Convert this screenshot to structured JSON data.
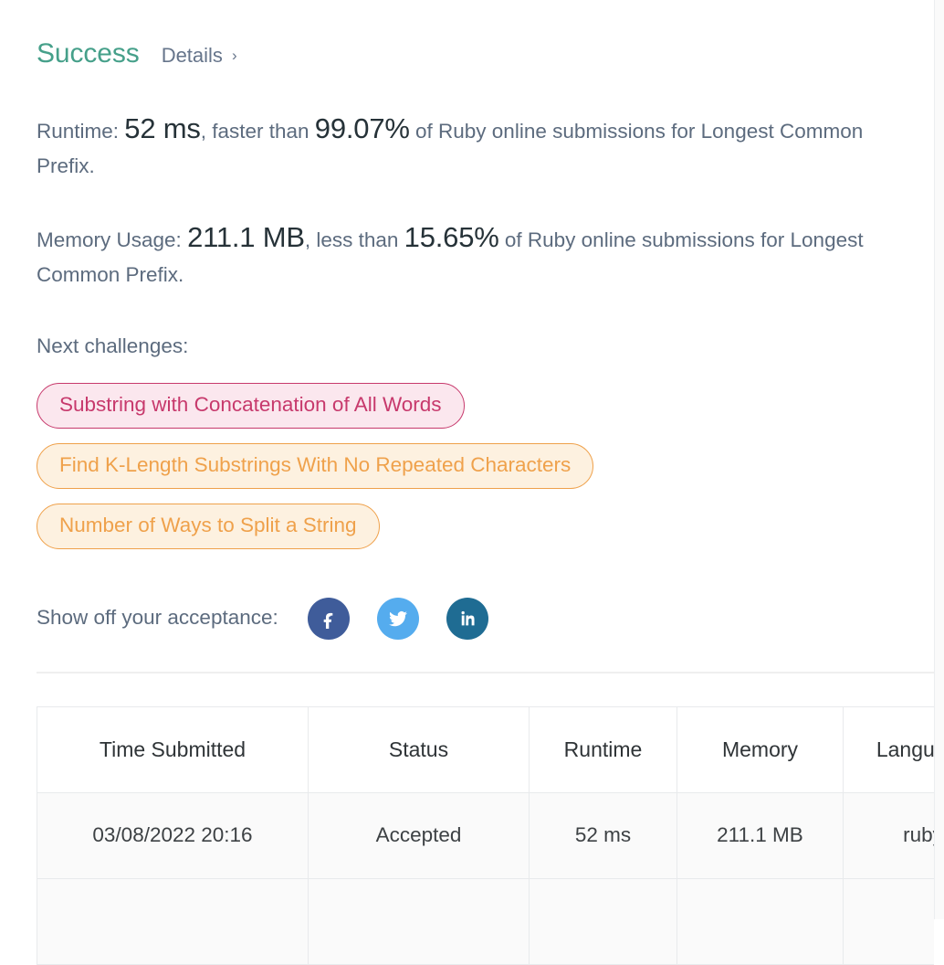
{
  "header": {
    "status": "Success",
    "details_label": "Details",
    "chevron": "›",
    "status_color": "#46a08a"
  },
  "runtime_stat": {
    "prefix": "Runtime: ",
    "value": "52 ms",
    "middle": ", faster than ",
    "percent": "99.07%",
    "suffix": " of Ruby online submissions for Longest Common Prefix."
  },
  "memory_stat": {
    "prefix": "Memory Usage: ",
    "value": "211.1 MB",
    "middle": ", less than ",
    "percent": "15.65%",
    "suffix": " of Ruby online submissions for Longest Common Prefix."
  },
  "next_challenges": {
    "label": "Next challenges:",
    "items": [
      {
        "title": "Substring with Concatenation of All Words",
        "difficulty": "hard",
        "color": "#c7396c",
        "background": "#fbe7ee"
      },
      {
        "title": "Find K-Length Substrings With No Repeated Characters",
        "difficulty": "medium",
        "color": "#efa14b",
        "background": "#fdf1e0"
      },
      {
        "title": "Number of Ways to Split a String",
        "difficulty": "medium",
        "color": "#efa14b",
        "background": "#fdf1e0"
      }
    ]
  },
  "share": {
    "label": "Show off your acceptance:",
    "buttons": [
      {
        "name": "facebook",
        "color": "#3f5c9a"
      },
      {
        "name": "twitter",
        "color": "#55acee"
      },
      {
        "name": "linkedin",
        "color": "#1f6c93"
      }
    ]
  },
  "submissions_table": {
    "columns": [
      "Time Submitted",
      "Status",
      "Runtime",
      "Memory",
      "Language"
    ],
    "rows": [
      {
        "time_submitted": "03/08/2022 20:16",
        "status": "Accepted",
        "runtime": "52 ms",
        "memory": "211.1 MB",
        "language": "ruby"
      }
    ],
    "accepted_color": "#2e9379"
  }
}
